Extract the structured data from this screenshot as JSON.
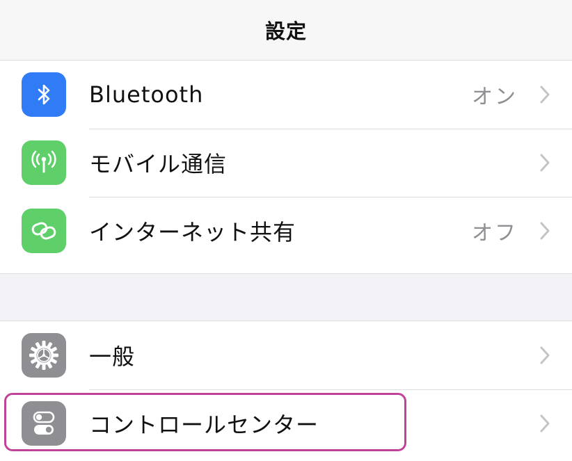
{
  "header": {
    "title": "設定"
  },
  "group1": {
    "items": [
      {
        "label": "Bluetooth",
        "value": "オン",
        "icon": "bluetooth-icon",
        "icon_color": "#2f7cf6"
      },
      {
        "label": "モバイル通信",
        "value": "",
        "icon": "antenna-icon",
        "icon_color": "#5fcf6a"
      },
      {
        "label": "インターネット共有",
        "value": "オフ",
        "icon": "hotspot-link-icon",
        "icon_color": "#5fcf6a"
      }
    ]
  },
  "group2": {
    "items": [
      {
        "label": "一般",
        "value": "",
        "icon": "gear-icon",
        "icon_color": "#8e8e93"
      },
      {
        "label": "コントロールセンター",
        "value": "",
        "icon": "toggles-icon",
        "icon_color": "#8e8e93",
        "highlighted": true
      }
    ]
  },
  "colors": {
    "background": "#f2f2f7",
    "secondary_text": "#8e8e93",
    "highlight_border": "#c0439a"
  }
}
